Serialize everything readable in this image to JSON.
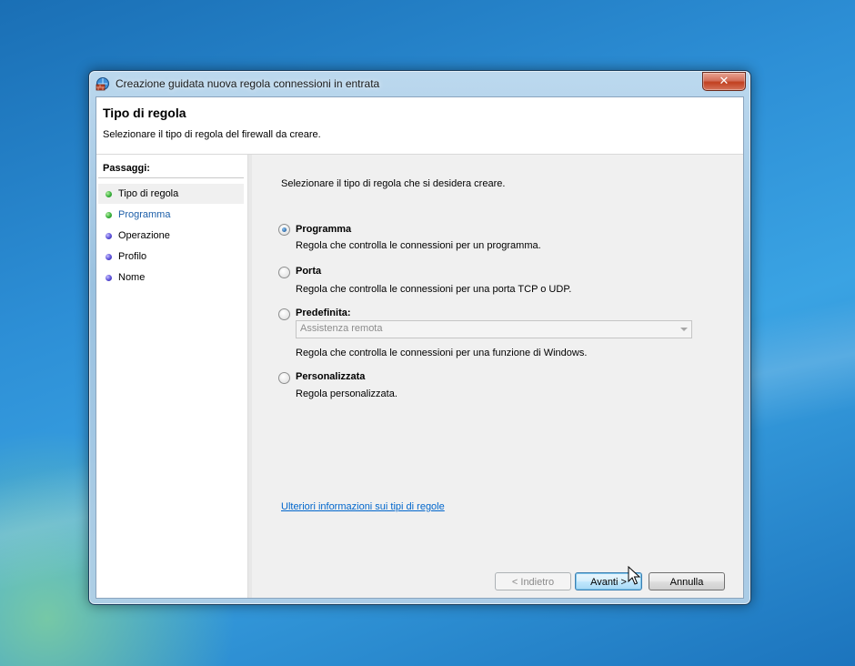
{
  "window": {
    "title": "Creazione guidata nuova regola connessioni in entrata",
    "close_label": "✕"
  },
  "header": {
    "title": "Tipo di regola",
    "subtitle": "Selezionare il tipo di regola del firewall da creare."
  },
  "sidebar": {
    "heading": "Passaggi:",
    "steps": [
      {
        "label": "Tipo di regola",
        "status": "completed",
        "current": true
      },
      {
        "label": "Programma",
        "status": "completed",
        "current": false
      },
      {
        "label": "Operazione",
        "status": "pending",
        "current": false
      },
      {
        "label": "Profilo",
        "status": "pending",
        "current": false
      },
      {
        "label": "Nome",
        "status": "pending",
        "current": false
      }
    ]
  },
  "main": {
    "prompt": "Selezionare il tipo di regola che si desidera creare.",
    "options": [
      {
        "label": "Programma",
        "description": "Regola che controlla le connessioni per un programma.",
        "checked": true
      },
      {
        "label": "Porta",
        "description": "Regola che controlla le connessioni per una porta TCP o UDP.",
        "checked": false
      },
      {
        "label": "Predefinita:",
        "description": "Regola che controlla le connessioni per una funzione di Windows.",
        "checked": false
      },
      {
        "label": "Personalizzata",
        "description": "Regola personalizzata.",
        "checked": false
      }
    ],
    "predefined_select": {
      "value": "Assistenza remota",
      "enabled": false
    },
    "help_link": "Ulteriori informazioni sui tipi di regole"
  },
  "buttons": {
    "back": "< Indietro",
    "next": "Avanti >",
    "cancel": "Annulla"
  },
  "colors": {
    "link": "#0066cc",
    "completed_step": "#38b03a",
    "pending_step": "#5b4fd8"
  }
}
